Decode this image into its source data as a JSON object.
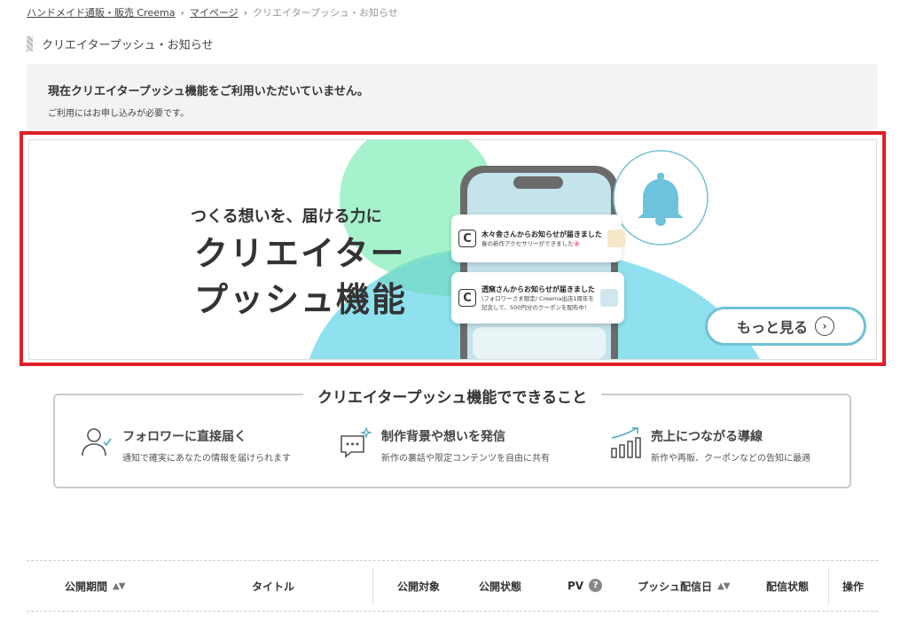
{
  "breadcrumb": {
    "home": "ハンドメイド通販・販売 Creema",
    "mypage": "マイページ",
    "current": "クリエイタープッシュ・お知らせ",
    "separator": "›"
  },
  "page": {
    "heading": "クリエイタープッシュ・お知らせ"
  },
  "notice": {
    "title": "現在クリエイタープッシュ機能をご利用いただいていません。",
    "subtitle": "ご利用にはお申し込みが必要です。"
  },
  "banner": {
    "catchcopy": "つくる想いを、届ける力に",
    "title_line1": "クリエイター",
    "title_line2": "プッシュ機能",
    "notifications": [
      {
        "title": "木々舎さんからお知らせが届きました",
        "text": "春の新作アクセサリーができました🌸"
      },
      {
        "title": "透窯さんからお知らせが届きました",
        "text_line1": "\\フォロワーさま限定/ Creema出店1周年を",
        "text_line2": "記念して、500円分のクーポンを配布中！"
      }
    ],
    "logo_letter": "C",
    "more_button": "もっと見る",
    "more_arrow": "›",
    "colors": {
      "frame": "#e01e26",
      "mint": "#a6f2cc",
      "sky": "#8fe1ef",
      "teal": "#6ec2d4",
      "bell": "#6cc3db"
    }
  },
  "features": {
    "title": "クリエイタープッシュ機能でできること",
    "items": [
      {
        "icon": "user-check-icon",
        "heading": "フォロワーに直接届く",
        "desc": "通知で確実にあなたの情報を届けられます"
      },
      {
        "icon": "chat-sparkle-icon",
        "heading": "制作背景や想いを発信",
        "desc": "新作の裏話や限定コンテンツを自由に共有"
      },
      {
        "icon": "growth-chart-icon",
        "heading": "売上につながる導線",
        "desc": "新作や再販、クーポンなどの告知に最適"
      }
    ]
  },
  "table": {
    "columns": {
      "period": "公開期間",
      "title": "タイトル",
      "target": "公開対象",
      "status": "公開状態",
      "pv": "PV",
      "push_date": "プッシュ配信日",
      "delivery_status": "配信状態",
      "actions": "操作"
    },
    "sort_icon": "▲▼",
    "help_icon": "?"
  }
}
